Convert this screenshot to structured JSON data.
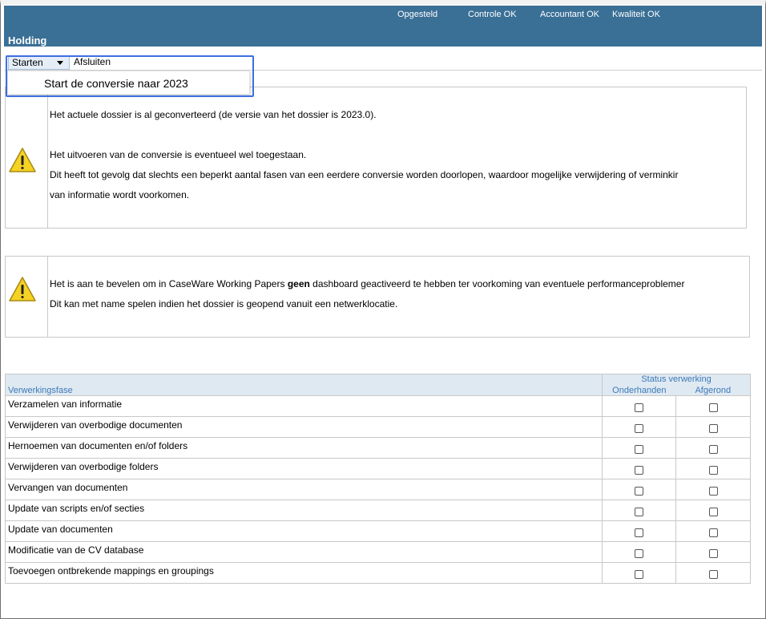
{
  "header": {
    "title": "Holding",
    "status_items": [
      "Opgesteld",
      "Controle OK",
      "Accountant OK",
      "Kwaliteit OK"
    ]
  },
  "menu": {
    "starten_label": "Starten",
    "afsluiten_label": "Afsluiten",
    "dropdown_item": "Start de conversie naar 2023"
  },
  "warning1": {
    "line1": "Het actuele dossier is al geconverteerd (de versie van het dossier is 2023.0).",
    "line2": "Het uitvoeren van de conversie is eventueel wel toegestaan.",
    "line3": "Dit heeft tot gevolg dat slechts een beperkt aantal fasen van een eerdere conversie worden doorlopen, waardoor mogelijke verwijdering of verminkir",
    "line4": "van informatie wordt voorkomen."
  },
  "warning2": {
    "line1_before": "Het is aan te bevelen om in CaseWare Working Papers ",
    "line1_bold": "geen",
    "line1_after": " dashboard geactiveerd te hebben ter voorkoming van eventuele performanceproblemer",
    "line2": "Dit kan met name spelen indien het dossier is geopend vanuit een netwerklocatie."
  },
  "table": {
    "col_phase": "Verwerkingsfase",
    "col_status": "Status verwerking",
    "col_onderhanden": "Onderhanden",
    "col_afgerond": "Afgerond",
    "rows": [
      "Verzamelen van informatie",
      "Verwijderen van overbodige documenten",
      "Hernoemen van documenten en/of folders",
      "Verwijderen van overbodige folders",
      "Vervangen van documenten",
      "Update van scripts en/of secties",
      "Update van documenten",
      "Modificatie van de CV database",
      "Toevoegen ontbrekende mappings en groupings"
    ]
  },
  "colors": {
    "header_bg": "#3a6f96",
    "table_header_bg": "#dfe9f2",
    "table_header_text": "#3d7ab8",
    "dropdown_highlight": "#3c6fe0"
  },
  "icons": [
    "warning-icon",
    "chevron-down-icon"
  ]
}
